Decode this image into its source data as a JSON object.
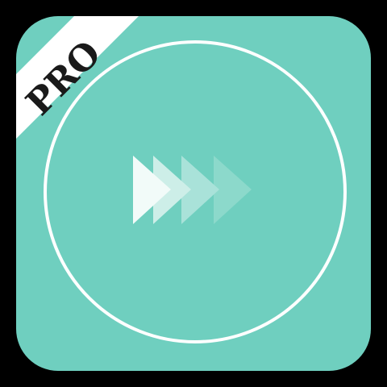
{
  "badge": {
    "text": "PRO"
  },
  "colors": {
    "background": "#000000",
    "icon_fill": "#6fcfbf",
    "ring": "#ffffff",
    "ribbon": "#ffffff",
    "ribbon_text": "#1a1a1a",
    "arrow_light": "#f2fbf9",
    "arrow_mid": "#cdeee8",
    "arrow_soft": "#a9e2d9",
    "arrow_faint": "#8fd9cc"
  },
  "icons": {
    "main": "fast-forward-icon"
  }
}
